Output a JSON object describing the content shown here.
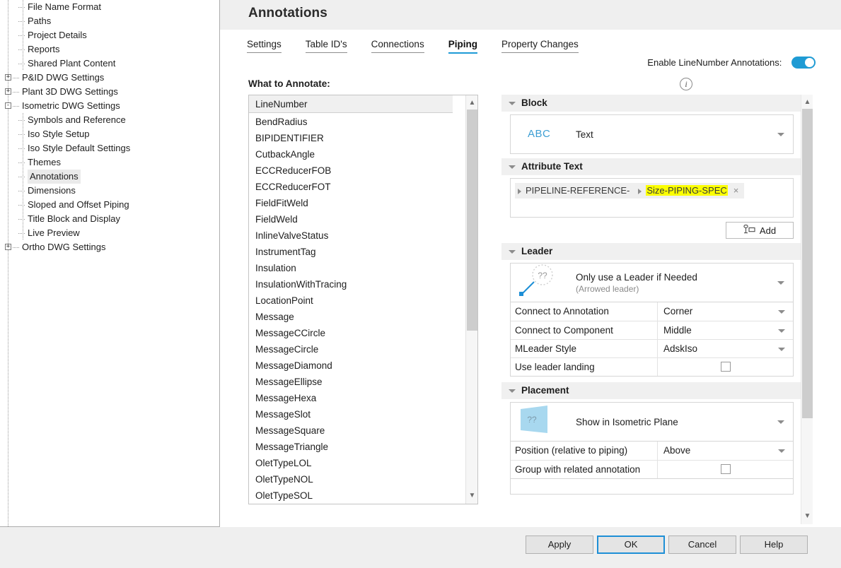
{
  "tree": {
    "nodes": [
      {
        "label": "File Name Format",
        "depth": 2,
        "expander": null
      },
      {
        "label": "Paths",
        "depth": 2,
        "expander": null
      },
      {
        "label": "Project Details",
        "depth": 2,
        "expander": null
      },
      {
        "label": "Reports",
        "depth": 2,
        "expander": null
      },
      {
        "label": "Shared Plant Content",
        "depth": 2,
        "expander": null
      },
      {
        "label": "P&ID DWG Settings",
        "depth": 1,
        "expander": "+"
      },
      {
        "label": "Plant 3D DWG Settings",
        "depth": 1,
        "expander": "+"
      },
      {
        "label": "Isometric DWG Settings",
        "depth": 1,
        "expander": "-"
      },
      {
        "label": "Symbols and Reference",
        "depth": 2,
        "expander": null
      },
      {
        "label": "Iso Style Setup",
        "depth": 2,
        "expander": null
      },
      {
        "label": "Iso Style Default Settings",
        "depth": 2,
        "expander": null
      },
      {
        "label": "Themes",
        "depth": 2,
        "expander": null
      },
      {
        "label": "Annotations",
        "depth": 2,
        "expander": null,
        "selected": true
      },
      {
        "label": "Dimensions",
        "depth": 2,
        "expander": null
      },
      {
        "label": "Sloped and Offset Piping",
        "depth": 2,
        "expander": null
      },
      {
        "label": "Title Block and Display",
        "depth": 2,
        "expander": null
      },
      {
        "label": "Live Preview",
        "depth": 2,
        "expander": null
      },
      {
        "label": "Ortho DWG Settings",
        "depth": 1,
        "expander": "+"
      }
    ]
  },
  "header": {
    "title": "Annotations"
  },
  "tabs": [
    {
      "label": "Settings",
      "active": false
    },
    {
      "label": "Table ID's",
      "active": false
    },
    {
      "label": "Connections",
      "active": false
    },
    {
      "label": "Piping",
      "active": true
    },
    {
      "label": "Property Changes",
      "active": false
    }
  ],
  "enable_toggle": {
    "label": "Enable LineNumber Annotations:",
    "on": true,
    "color": "#1f9bd4"
  },
  "what_to_annotate": {
    "label": "What to Annotate:",
    "info_icon": "info-icon",
    "selected": "LineNumber",
    "items": [
      "BendRadius",
      "BIPIDENTIFIER",
      "CutbackAngle",
      "ECCReducerFOB",
      "ECCReducerFOT",
      "FieldFitWeld",
      "FieldWeld",
      "InlineValveStatus",
      "InstrumentTag",
      "Insulation",
      "InsulationWithTracing",
      "LocationPoint",
      "Message",
      "MessageCCircle",
      "MessageCircle",
      "MessageDiamond",
      "MessageEllipse",
      "MessageHexa",
      "MessageSlot",
      "MessageSquare",
      "MessageTriangle",
      "OletTypeLOL",
      "OletTypeNOL",
      "OletTypeSOL"
    ],
    "add_button": "Add"
  },
  "block": {
    "section_title": "Block",
    "icon_text": "ABC",
    "value": "Text"
  },
  "attribute_text": {
    "section_title": "Attribute Text",
    "chips": [
      {
        "label": "PIPELINE-REFERENCE-",
        "highlighted": false,
        "closable": false
      },
      {
        "label": "Size-PIPING-SPEC",
        "highlighted": true,
        "closable": true,
        "highlight_color": "#fbff00"
      }
    ],
    "add_button": "Add"
  },
  "leader": {
    "section_title": "Leader",
    "preview_glyph": "??",
    "main_text": "Only use a Leader if Needed",
    "sub_text": "(Arrowed leader)",
    "rows": [
      {
        "label": "Connect to Annotation",
        "type": "select",
        "value": "Corner"
      },
      {
        "label": "Connect to Component",
        "type": "select",
        "value": "Middle"
      },
      {
        "label": "MLeader Style",
        "type": "select",
        "value": "AdskIso"
      },
      {
        "label": "Use leader landing",
        "type": "checkbox",
        "checked": false
      }
    ]
  },
  "placement": {
    "section_title": "Placement",
    "preview_glyph": "??",
    "main_text": "Show in Isometric Plane",
    "rows": [
      {
        "label": "Position (relative to piping)",
        "type": "select",
        "value": "Above"
      },
      {
        "label": "Group with related annotation",
        "type": "checkbox",
        "checked": false
      }
    ]
  },
  "footer": {
    "buttons": [
      {
        "label": "Apply",
        "primary": false
      },
      {
        "label": "OK",
        "primary": true
      },
      {
        "label": "Cancel",
        "primary": false
      },
      {
        "label": "Help",
        "primary": false
      }
    ]
  }
}
